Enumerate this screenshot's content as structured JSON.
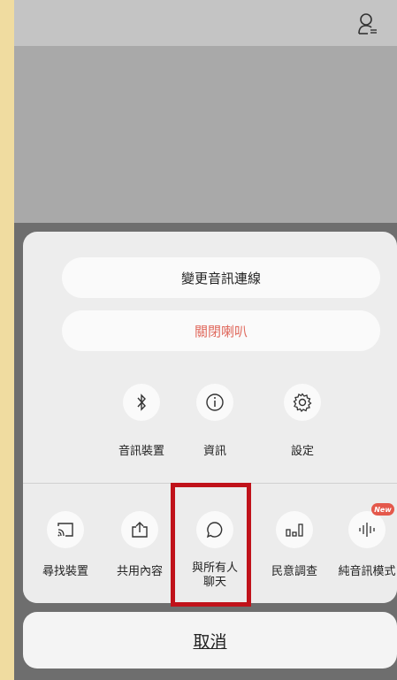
{
  "sheet": {
    "change_audio": "變更音訊連線",
    "close_speaker": "關閉喇叭",
    "row1": [
      {
        "label": "音訊裝置",
        "icon": "bluetooth-icon"
      },
      {
        "label": "資訊",
        "icon": "info-icon"
      },
      {
        "label": "設定",
        "icon": "gear-icon"
      }
    ],
    "row2": [
      {
        "label": "尋找裝置",
        "icon": "cast-icon"
      },
      {
        "label": "共用內容",
        "icon": "share-icon"
      },
      {
        "label_line1": "與所有人",
        "label_line2": "聊天",
        "icon": "chat-icon"
      },
      {
        "label": "民意調查",
        "icon": "poll-icon"
      },
      {
        "label": "純音訊模式",
        "icon": "audio-wave-icon",
        "badge": "New"
      }
    ]
  },
  "cancel_label": "取消",
  "colors": {
    "accent_red": "#e06a5e",
    "highlight": "#c0121a",
    "badge": "#e4584b"
  }
}
